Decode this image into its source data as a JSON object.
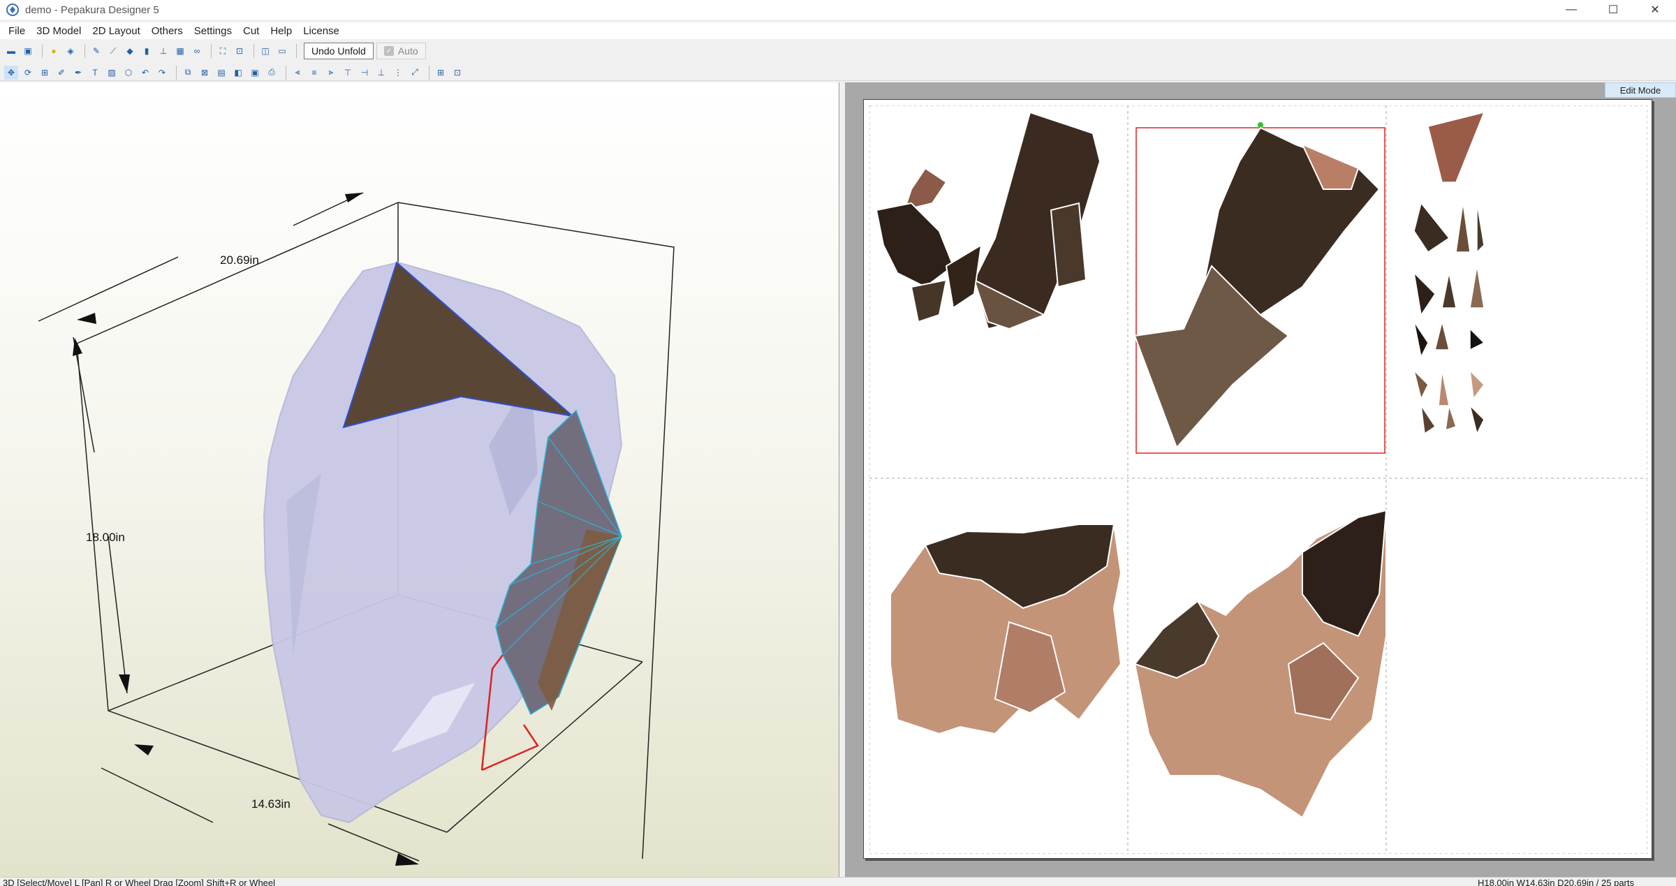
{
  "window": {
    "title": "demo - Pepakura Designer 5",
    "minimize": "—",
    "maximize": "☐",
    "close": "✕"
  },
  "menu": [
    "File",
    "3D Model",
    "2D Layout",
    "Others",
    "Settings",
    "Cut",
    "Help",
    "License"
  ],
  "toolbar": {
    "undo_unfold_label": "Undo Unfold",
    "auto_label": "Auto",
    "row1_icons": [
      "open-icon",
      "save-icon",
      "light-icon",
      "texture-icon",
      "edge-icon",
      "fold-icon",
      "paint-icon",
      "cylinder-icon",
      "axis-icon",
      "grid-icon",
      "link-icon",
      "zoom-fit-icon",
      "zoom-select-icon",
      "view-split-icon",
      "view-single-icon"
    ],
    "row2_icons": [
      "select-icon",
      "rotate-icon",
      "unfold-icon",
      "edit-icon",
      "pen-icon",
      "text-icon",
      "image-icon",
      "cube-icon",
      "undo-icon",
      "redo-icon",
      "join-icon",
      "arrange-icon",
      "page-icon",
      "flap-icon",
      "print-icon",
      "align-left-icon",
      "align-center-icon",
      "align-right-icon",
      "align-top-icon",
      "align-middle-icon",
      "align-bottom-icon",
      "distribute-icon",
      "scale-icon",
      "fit-page-icon",
      "settings-icon"
    ]
  },
  "view3d": {
    "dim_width": "20.69in",
    "dim_height": "18.00in",
    "dim_depth": "14.63in"
  },
  "view2d": {
    "edit_mode_label": "Edit Mode"
  },
  "status": {
    "left": "3D [Select/Move] L [Pan] R or Wheel Drag [Zoom] Shift+R or Wheel",
    "right": "H18.00in W14.63in D20.69in / 25 parts"
  }
}
